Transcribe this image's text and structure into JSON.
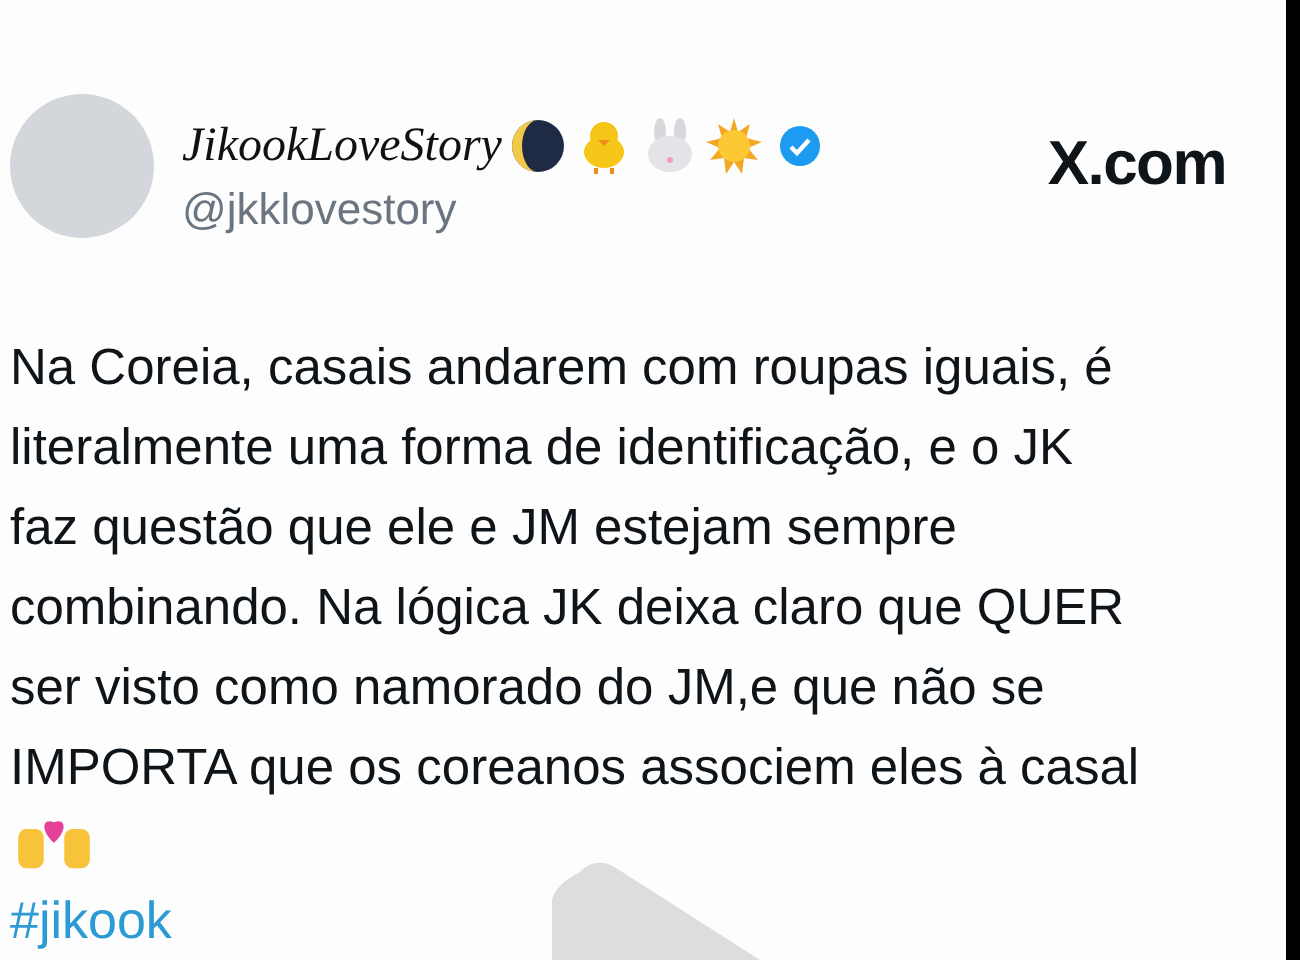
{
  "tweet": {
    "display_name": "JikookLoveStory",
    "verified": true,
    "handle": "@jkklovestory",
    "brand": "X.com",
    "body_lines": [
      "Na Coreia, casais andarem com roupas iguais, é",
      "literalmente uma forma de identificação, e o JK",
      "faz questão que ele e JM estejam sempre",
      "combinando. Na lógica JK deixa claro que QUER",
      "ser visto como namorado do JM,e que não se",
      "IMPORTA que os coreanos associem eles à casal"
    ],
    "hashtag": "#jikook"
  }
}
